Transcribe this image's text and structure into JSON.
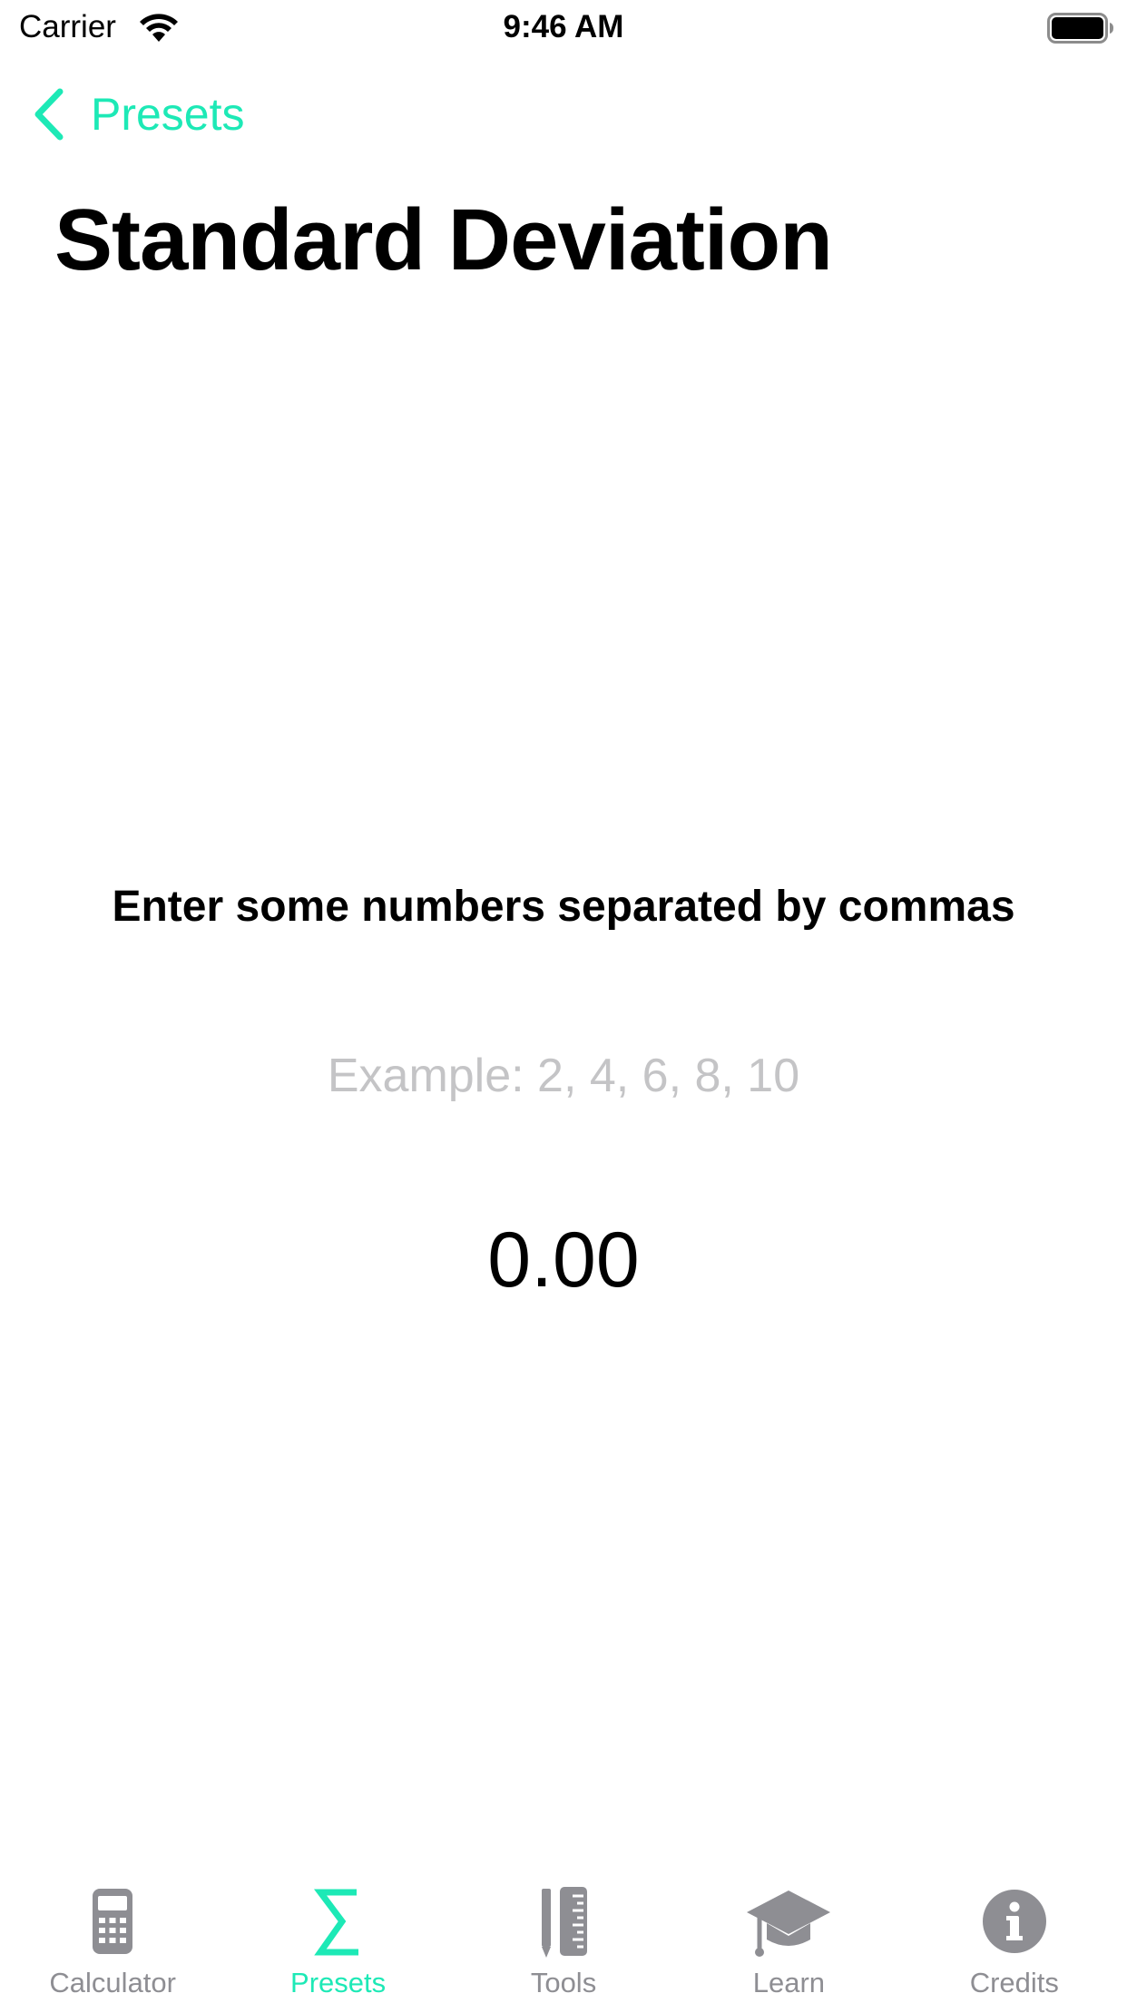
{
  "status_bar": {
    "carrier": "Carrier",
    "time": "9:46 AM",
    "wifi_icon": "wifi-icon",
    "battery_icon": "battery-icon"
  },
  "nav": {
    "back_label": "Presets",
    "back_icon": "chevron-left-icon"
  },
  "page": {
    "title": "Standard Deviation",
    "instructions": "Enter some numbers separated by commas",
    "input_value": "",
    "input_placeholder": "Example: 2, 4, 6, 8, 10",
    "result": "0.00"
  },
  "tab_bar": {
    "tabs": [
      {
        "label": "Calculator",
        "icon": "calculator-icon",
        "active": false
      },
      {
        "label": "Presets",
        "icon": "sigma-icon",
        "active": true
      },
      {
        "label": "Tools",
        "icon": "ruler-pencil-icon",
        "active": false
      },
      {
        "label": "Learn",
        "icon": "graduation-cap-icon",
        "active": false
      },
      {
        "label": "Credits",
        "icon": "info-icon",
        "active": false
      }
    ]
  },
  "colors": {
    "accent": "#1de9b6",
    "inactive": "#8e8e93",
    "placeholder": "#c4c4c6",
    "text": "#000000",
    "background": "#ffffff"
  }
}
